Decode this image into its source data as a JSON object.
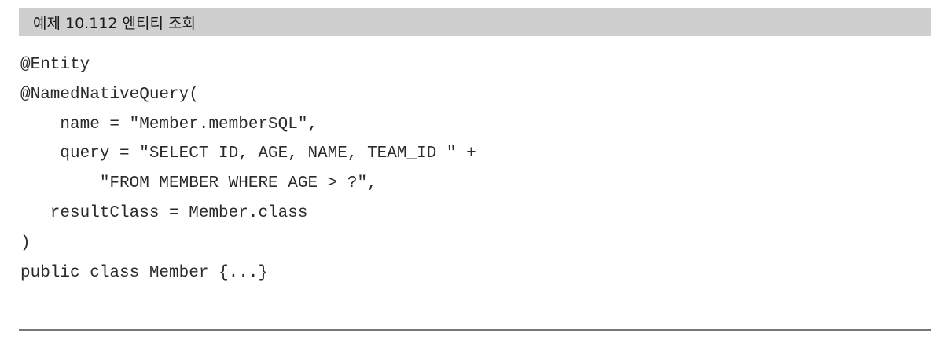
{
  "caption": "예제 10.112 엔티티 조회",
  "code_lines": [
    "@Entity",
    "@NamedNativeQuery(",
    "    name = \"Member.memberSQL\",",
    "    query = \"SELECT ID, AGE, NAME, TEAM_ID \" +",
    "        \"FROM MEMBER WHERE AGE > ?\",",
    "   resultClass = Member.class",
    ")",
    "public class Member {...}"
  ]
}
